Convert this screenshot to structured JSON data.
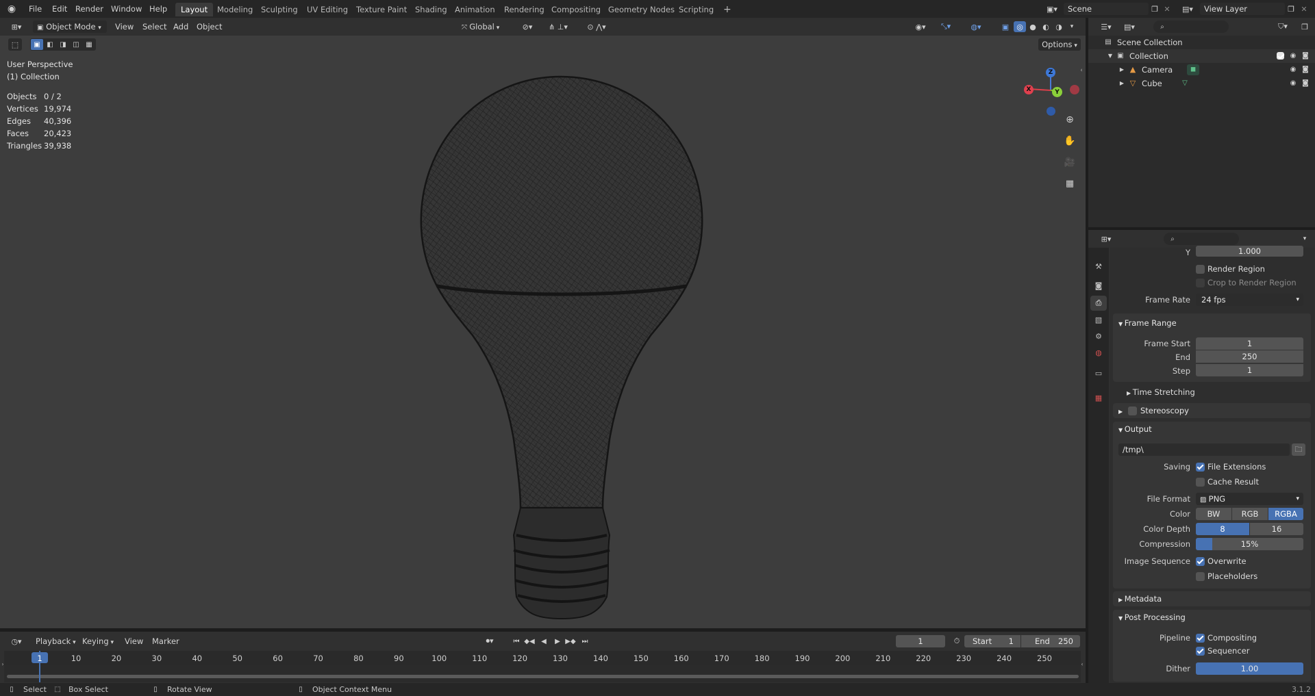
{
  "topbar": {
    "menus": [
      "File",
      "Edit",
      "Render",
      "Window",
      "Help"
    ],
    "workspaces": [
      "Layout",
      "Modeling",
      "Sculpting",
      "UV Editing",
      "Texture Paint",
      "Shading",
      "Animation",
      "Rendering",
      "Compositing",
      "Geometry Nodes",
      "Scripting"
    ],
    "active_workspace": "Layout",
    "add_tab": "+",
    "scene": "Scene",
    "view_layer": "View Layer"
  },
  "viewport": {
    "mode": "Object Mode",
    "menus": [
      "View",
      "Select",
      "Add",
      "Object"
    ],
    "orientation": "Global",
    "options": "Options",
    "overlay_title": "User Perspective",
    "overlay_collection": "(1) Collection",
    "stats": [
      {
        "label": "Objects",
        "value": "0 / 2"
      },
      {
        "label": "Vertices",
        "value": "19,974"
      },
      {
        "label": "Edges",
        "value": "40,396"
      },
      {
        "label": "Faces",
        "value": "20,423"
      },
      {
        "label": "Triangles",
        "value": "39,938"
      }
    ],
    "gizmo": {
      "x": "X",
      "y": "Y",
      "z": "Z"
    }
  },
  "timeline": {
    "menus": [
      "Playback",
      "Keying",
      "View",
      "Marker"
    ],
    "current_frame": "1",
    "start_label": "Start",
    "start": "1",
    "end_label": "End",
    "end": "250",
    "ticks": [
      "1",
      "10",
      "20",
      "30",
      "40",
      "50",
      "60",
      "70",
      "80",
      "90",
      "100",
      "110",
      "120",
      "130",
      "140",
      "150",
      "160",
      "170",
      "180",
      "190",
      "200",
      "210",
      "220",
      "230",
      "240",
      "250"
    ]
  },
  "statusbar": {
    "select": "Select",
    "box_select": "Box Select",
    "rotate": "Rotate View",
    "context": "Object Context Menu",
    "version": "3.1.2"
  },
  "outliner": {
    "root": "Scene Collection",
    "collection": "Collection",
    "items": [
      "Camera",
      "Cube"
    ]
  },
  "properties": {
    "res_y_label": "Y",
    "res_y": "1.000",
    "render_region": "Render Region",
    "crop": "Crop to Render Region",
    "frame_rate_label": "Frame Rate",
    "frame_rate": "24 fps",
    "frame_range": {
      "title": "Frame Range",
      "start_label": "Frame Start",
      "start": "1",
      "end_label": "End",
      "end": "250",
      "step_label": "Step",
      "step": "1"
    },
    "time_stretching": "Time Stretching",
    "stereoscopy": "Stereoscopy",
    "output": {
      "title": "Output",
      "path": "/tmp\\",
      "saving_label": "Saving",
      "file_extensions": "File Extensions",
      "cache_result": "Cache Result",
      "file_format_label": "File Format",
      "file_format": "PNG",
      "color_label": "Color",
      "color_options": [
        "BW",
        "RGB",
        "RGBA"
      ],
      "color_selected": "RGBA",
      "depth_label": "Color Depth",
      "depth_options": [
        "8",
        "16"
      ],
      "depth_selected": "8",
      "compression_label": "Compression",
      "compression": "15%",
      "compression_fraction": 0.15,
      "image_sequence_label": "Image Sequence",
      "overwrite": "Overwrite",
      "placeholders": "Placeholders"
    },
    "metadata": "Metadata",
    "post_processing": {
      "title": "Post Processing",
      "pipeline_label": "Pipeline",
      "compositing": "Compositing",
      "sequencer": "Sequencer",
      "dither_label": "Dither",
      "dither": "1.00"
    }
  }
}
